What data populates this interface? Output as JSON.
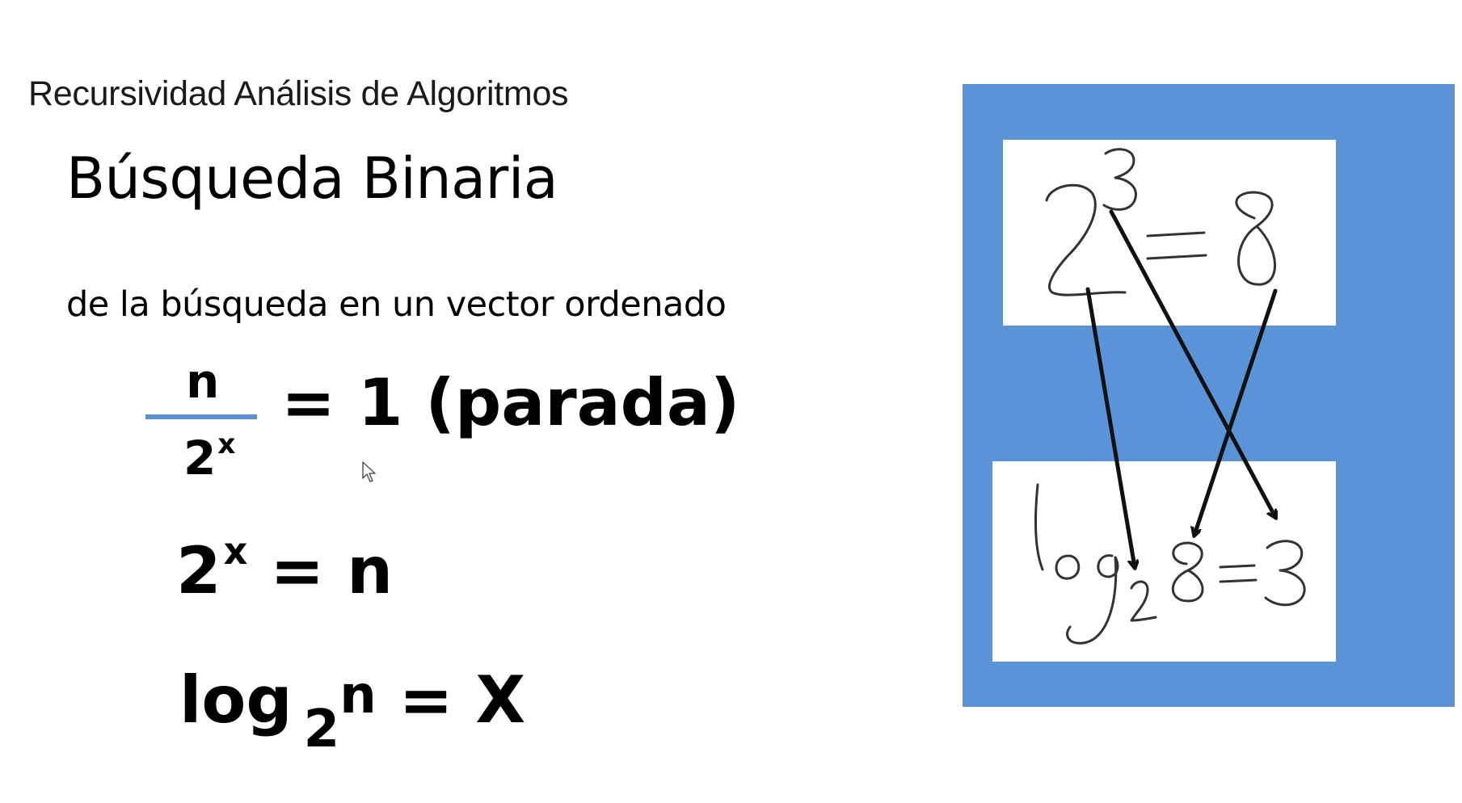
{
  "slide": {
    "course_title": "Recursividad Análisis de Algoritmos",
    "title": "Búsqueda Binaria",
    "subtitle": "de la búsqueda en un vector ordenado"
  },
  "equations": {
    "fraction": {
      "numerator": "n",
      "denominator_base": "2",
      "denominator_exponent": "x",
      "rhs": "= 1 (parada)"
    },
    "power": {
      "base": "2",
      "exponent": "x",
      "rhs": " = n"
    },
    "logarithm": {
      "log": "log",
      "base": "2",
      "argument": "n",
      "rhs": " = X"
    }
  },
  "handwritten": {
    "top": {
      "base": "2",
      "exponent": "3",
      "equals": "=",
      "result": "8"
    },
    "bottom": {
      "log": "log",
      "base": "2",
      "argument": "8",
      "equals": "=",
      "result": "3"
    }
  },
  "colors": {
    "panel_blue": "#5b93d8",
    "fraction_bar": "#5b8fd1",
    "ink": "#111111"
  },
  "icons": {
    "cursor": "mouse-pointer-icon"
  }
}
